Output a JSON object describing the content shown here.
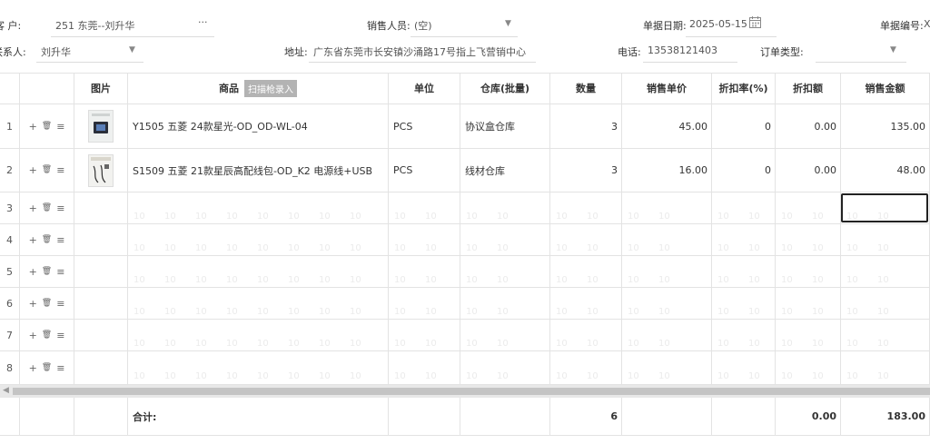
{
  "header": {
    "customer_label": "客  户:",
    "customer_value": "251 东莞--刘升华",
    "customer_more": "···",
    "sales_label": "销售人员:",
    "sales_value": "(空)",
    "date_label": "单据日期:",
    "date_value": "2025-05-15",
    "docno_label": "单据编号:",
    "docno_value": "X",
    "contact_label": "联系人:",
    "contact_value": "刘升华",
    "address_label": "地址:",
    "address_value": "广东省东莞市长安镇沙涌路17号指上飞营销中心",
    "phone_label": "电话:",
    "phone_value": "13538121403",
    "ordertype_label": "订单类型:",
    "ordertype_value": ""
  },
  "table": {
    "columns": {
      "image": "图片",
      "product": "商品",
      "scan": "扫描枪录入",
      "unit": "单位",
      "warehouse": "仓库(批量)",
      "qty": "数量",
      "price": "销售单价",
      "discount_rate": "折扣率(%)",
      "discount_amount": "折扣额",
      "amount": "销售金额"
    },
    "rows": [
      {
        "no": "1",
        "product": "Y1505 五菱 24款星光-OD_OD-WL-04",
        "unit": "PCS",
        "warehouse": "协议盒仓库",
        "qty": "3",
        "price": "45.00",
        "discount_rate": "0",
        "discount_amount": "0.00",
        "amount": "135.00"
      },
      {
        "no": "2",
        "product": "S1509 五菱 21款星辰高配线包-OD_K2 电源线+USB",
        "unit": "PCS",
        "warehouse": "线材仓库",
        "qty": "3",
        "price": "16.00",
        "discount_rate": "0",
        "discount_amount": "0.00",
        "amount": "48.00"
      },
      {
        "no": "3"
      },
      {
        "no": "4"
      },
      {
        "no": "5"
      },
      {
        "no": "6"
      },
      {
        "no": "7"
      },
      {
        "no": "8"
      }
    ],
    "footer": {
      "label": "合计:",
      "qty": "6",
      "discount_amount": "0.00",
      "amount": "183.00"
    },
    "ops": {
      "add": "+",
      "delete": "🗑",
      "detail": "≡"
    },
    "watermark": "10"
  },
  "colors": {
    "accent": "#222222",
    "scan_badge": "#b3b3b3",
    "scrollbar": "#c4c4c4"
  }
}
